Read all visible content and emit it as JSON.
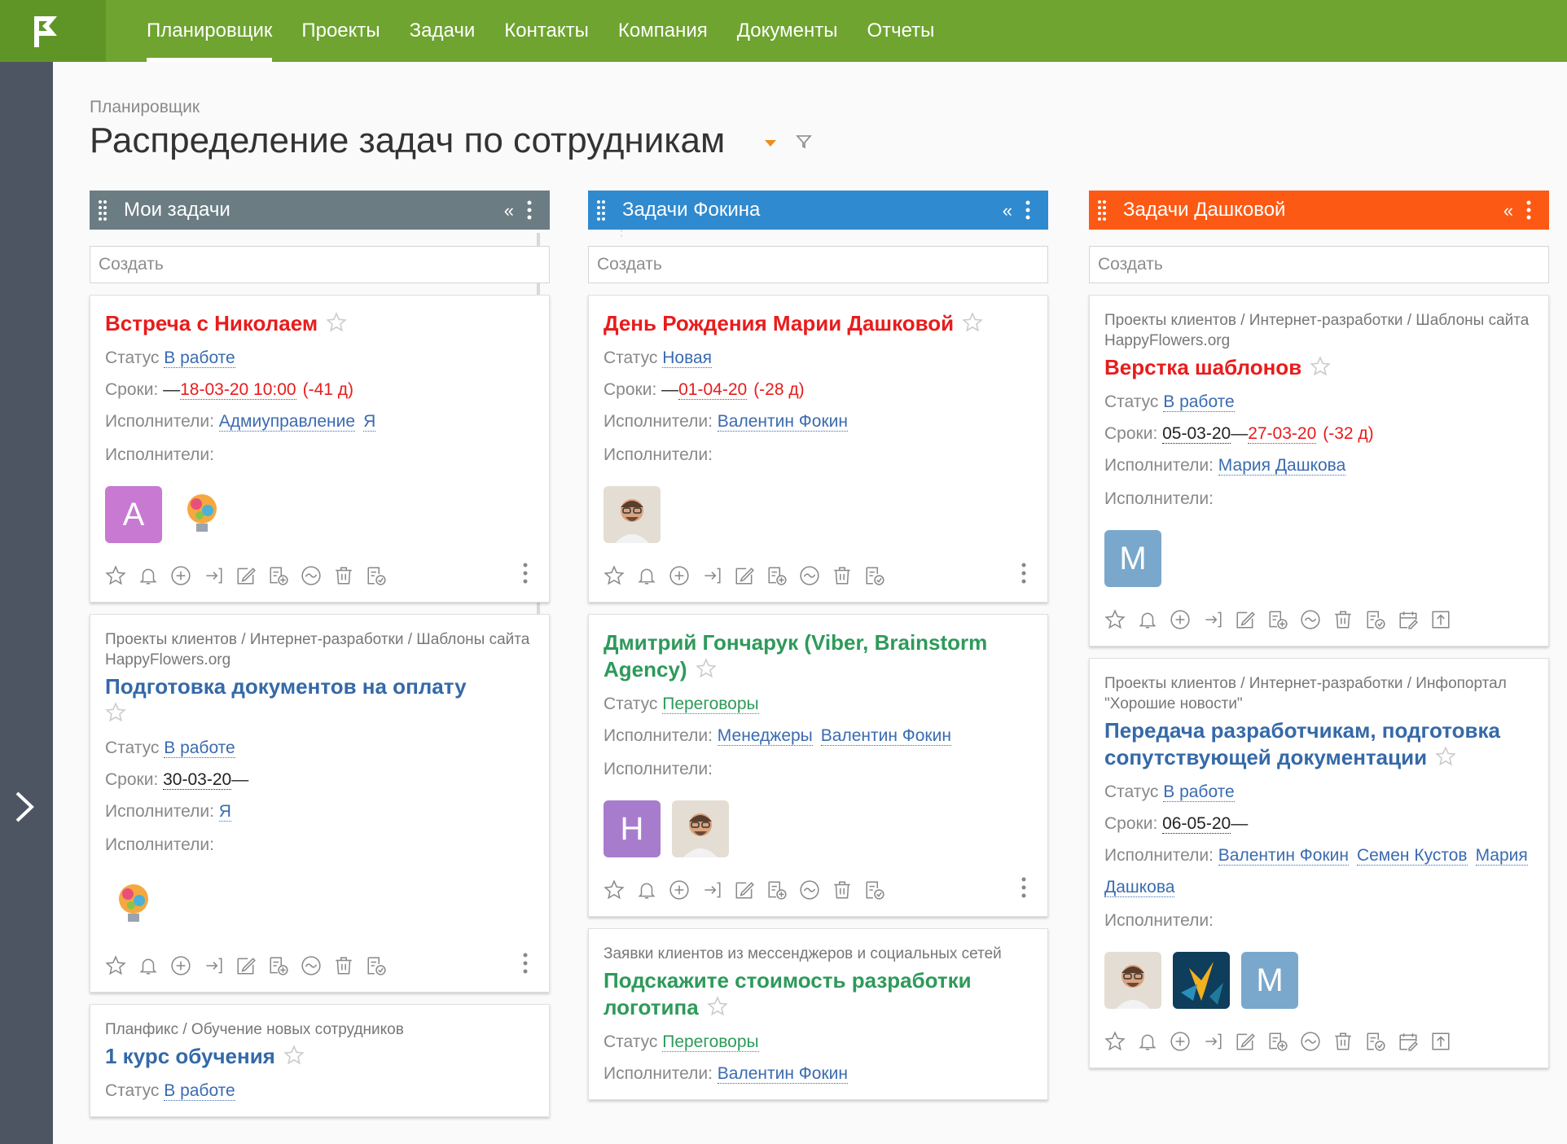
{
  "nav": {
    "items": [
      "Планировщик",
      "Проекты",
      "Задачи",
      "Контакты",
      "Компания",
      "Документы",
      "Отчеты"
    ],
    "active_index": 0
  },
  "page": {
    "breadcrumb": "Планировщик",
    "title": "Распределение задач по сотрудникам"
  },
  "labels": {
    "status": "Статус",
    "deadline": "Сроки:",
    "executors": "Исполнители:",
    "create_placeholder": "Создать"
  },
  "colors": {
    "topbar": "#6ea42f",
    "col_mine": "#6b7c83",
    "col_fokin": "#2f8ad0",
    "col_dashkova": "#fc5a14",
    "red": "#e81c1c",
    "blue": "#3569a8",
    "green": "#2e9a5a"
  },
  "columns": [
    {
      "title": "Мои задачи",
      "cards": [
        {
          "title": "Встреча с Николаем",
          "status": "В работе",
          "date_start": "",
          "date_end": "18-03-20 10:00",
          "overdue": "(-41 д)",
          "executors": [
            "Адмиуправление",
            "Я"
          ],
          "avatars": [
            "A",
            "bulb"
          ]
        },
        {
          "path": "Проекты клиентов / Интернет-разработки / Шаблоны сайта HappyFlowers.org",
          "title": "Подготовка документов на оплату",
          "status": "В работе",
          "date_start": "30-03-20",
          "executors": [
            "Я"
          ],
          "avatars": [
            "bulb"
          ]
        },
        {
          "path": "Планфикс / Обучение новых сотрудников",
          "title": "1 курс обучения",
          "status": "В работе"
        }
      ]
    },
    {
      "title": "Задачи Фокина",
      "cards": [
        {
          "title": "День Рождения Марии Дашковой",
          "status": "Новая",
          "date_end": "01-04-20",
          "overdue": "(-28 д)",
          "executors": [
            "Валентин Фокин"
          ],
          "avatars": [
            "photo"
          ]
        },
        {
          "title": "Дмитрий Гончарук (Viber, Brainstorm Agency)",
          "status": "Переговоры",
          "executors": [
            "Менеджеры",
            "Валентин Фокин"
          ],
          "avatars": [
            "H",
            "photo"
          ]
        },
        {
          "path": "Заявки клиентов из мессенджеров и социальных сетей",
          "title": "Подскажите стоимость разработки логотипа",
          "status": "Переговоры",
          "executors": [
            "Валентин Фокин"
          ]
        }
      ]
    },
    {
      "title": "Задачи Дашковой",
      "cards": [
        {
          "path": "Проекты клиентов / Интернет-разработки / Шаблоны сайта HappyFlowers.org",
          "title": "Верстка шаблонов",
          "status": "В работе",
          "date_start": "05-03-20",
          "date_end": "27-03-20",
          "overdue": "(-32 д)",
          "executors": [
            "Мария Дашкова"
          ],
          "avatars": [
            "M"
          ]
        },
        {
          "path": "Проекты клиентов / Интернет-разработки / Инфопортал \"Хорошие новости\"",
          "title": "Передача разработчикам, подготовка сопутствующей документации",
          "status": "В работе",
          "date_start": "06-05-20",
          "executors": [
            "Валентин Фокин",
            "Семен Кустов",
            "Мария Дашкова"
          ],
          "avatars": [
            "photo",
            "flower",
            "M"
          ]
        }
      ]
    }
  ]
}
